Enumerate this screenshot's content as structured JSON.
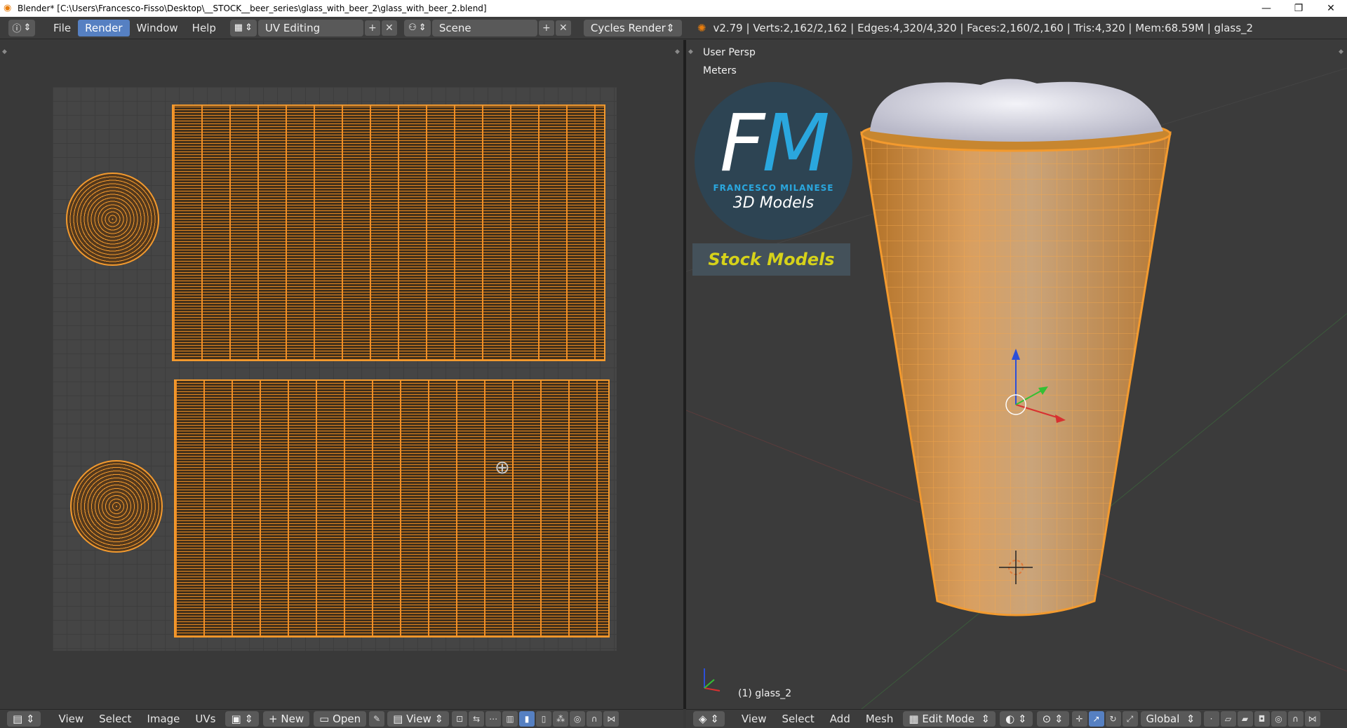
{
  "titlebar": {
    "title": "Blender* [C:\\Users\\Francesco-Fisso\\Desktop\\__STOCK__beer_series\\glass_with_beer_2\\glass_with_beer_2.blend]",
    "minimize": "—",
    "restore": "❐",
    "close": "✕"
  },
  "infobar": {
    "menu": [
      "File",
      "Render",
      "Window",
      "Help"
    ],
    "active_menu": "Render",
    "screen_layout": "UV Editing",
    "scene": "Scene",
    "render_engine": "Cycles Render",
    "stats": "v2.79 | Verts:2,162/2,162 | Edges:4,320/4,320 | Faces:2,160/2,160 | Tris:4,320 | Mem:68.59M | glass_2"
  },
  "viewport": {
    "view_name": "User Persp",
    "units": "Meters",
    "object_label": "(1) glass_2",
    "logo": {
      "letter_f": "F",
      "letter_m": "M",
      "name": "FRANCESCO MILANESE",
      "subtitle": "3D Models",
      "stock": "Stock Models"
    }
  },
  "uv_header": {
    "menus": [
      "View",
      "Select",
      "Image",
      "UVs"
    ],
    "new_label": "New",
    "open_label": "Open",
    "view_label": "View"
  },
  "view3d_header": {
    "menus": [
      "View",
      "Select",
      "Add",
      "Mesh"
    ],
    "mode": "Edit Mode",
    "orientation": "Global"
  },
  "colors": {
    "accent": "#5680c2",
    "selection_orange": "#f39a2e",
    "logo_blue": "#2aa7de",
    "stock_yellow": "#d6d21a"
  }
}
